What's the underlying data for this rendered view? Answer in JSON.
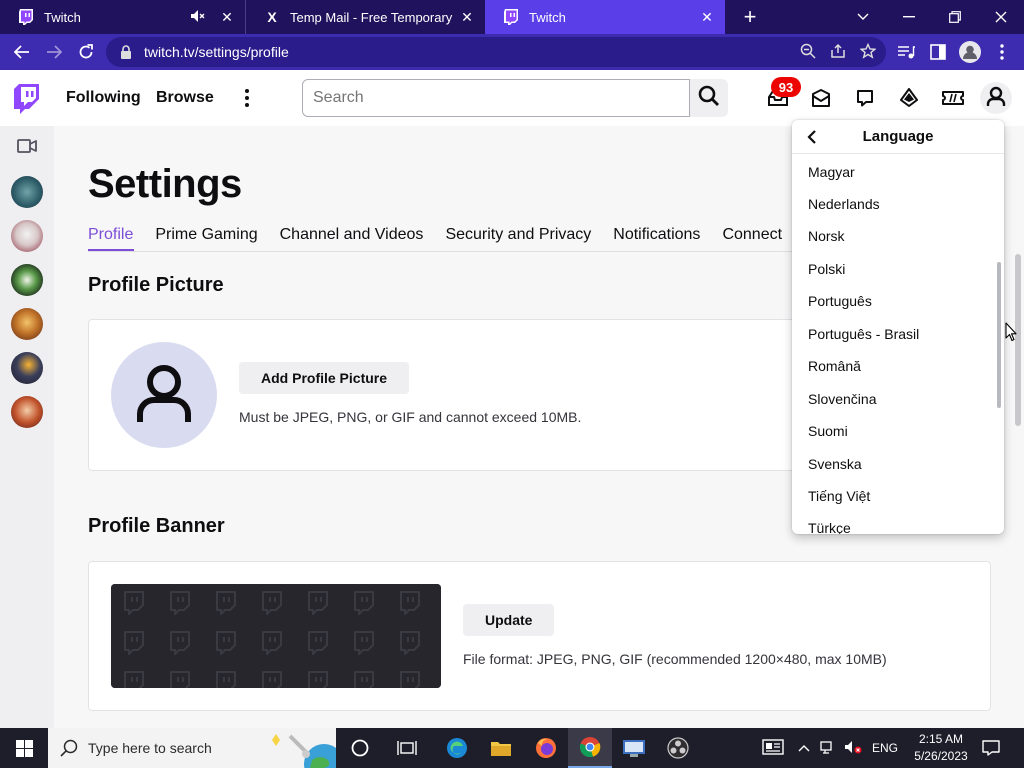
{
  "browser": {
    "tabs": [
      {
        "title": "Twitch"
      },
      {
        "title": "Temp Mail - Free Temporary Ema"
      },
      {
        "title": "Twitch"
      }
    ],
    "url": "twitch.tv/settings/profile"
  },
  "topnav": {
    "following": "Following",
    "browse": "Browse",
    "search_placeholder": "Search",
    "notification_count": "93"
  },
  "settings": {
    "title": "Settings",
    "tabs": [
      "Profile",
      "Prime Gaming",
      "Channel and Videos",
      "Security and Privacy",
      "Notifications",
      "Connect"
    ],
    "profile_picture": {
      "heading": "Profile Picture",
      "button": "Add Profile Picture",
      "help": "Must be JPEG, PNG, or GIF and cannot exceed 10MB."
    },
    "profile_banner": {
      "heading": "Profile Banner",
      "button": "Update",
      "help": "File format: JPEG, PNG, GIF (recommended 1200×480, max 10MB)"
    }
  },
  "language_menu": {
    "title": "Language",
    "items": [
      "Magyar",
      "Nederlands",
      "Norsk",
      "Polski",
      "Português",
      "Português - Brasil",
      "Română",
      "Slovenčina",
      "Suomi",
      "Svenska",
      "Tiếng Việt",
      "Türkçe"
    ]
  },
  "taskbar": {
    "search_placeholder": "Type here to search",
    "language": "ENG",
    "time": "2:15 AM",
    "date": "5/26/2023"
  },
  "colors": {
    "twitch_purple": "#9146ff",
    "tab_bar": "#20125c",
    "address_bar": "#3d2bb0",
    "active_tab": "#7c4dd6",
    "badge": "#eb0400"
  }
}
